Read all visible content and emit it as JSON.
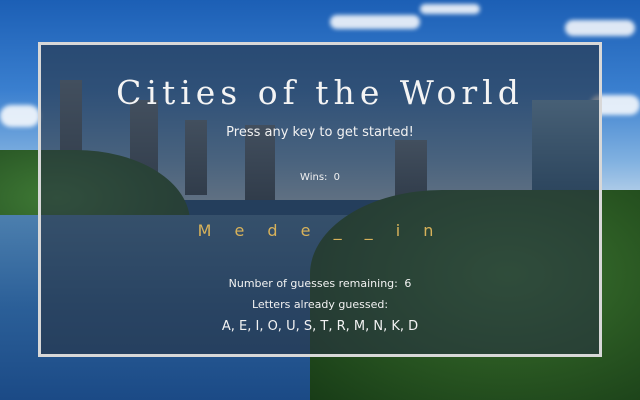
{
  "game": {
    "title": "Cities of the World",
    "prompt": "Press any key to get started!",
    "wins_label": "Wins:",
    "wins": "0",
    "word": "M e d e _ _ i n",
    "guesses_label": "Number of guesses remaining:",
    "guesses_remaining": "6",
    "letters_label": "Letters already guessed:",
    "letters_guessed": "A, E, I, O, U, S, T, R, M, N, K, D"
  },
  "colors": {
    "panel_border": "#d8d8d8",
    "word_color": "#d8b25a",
    "text_color": "#f2f2f2"
  }
}
